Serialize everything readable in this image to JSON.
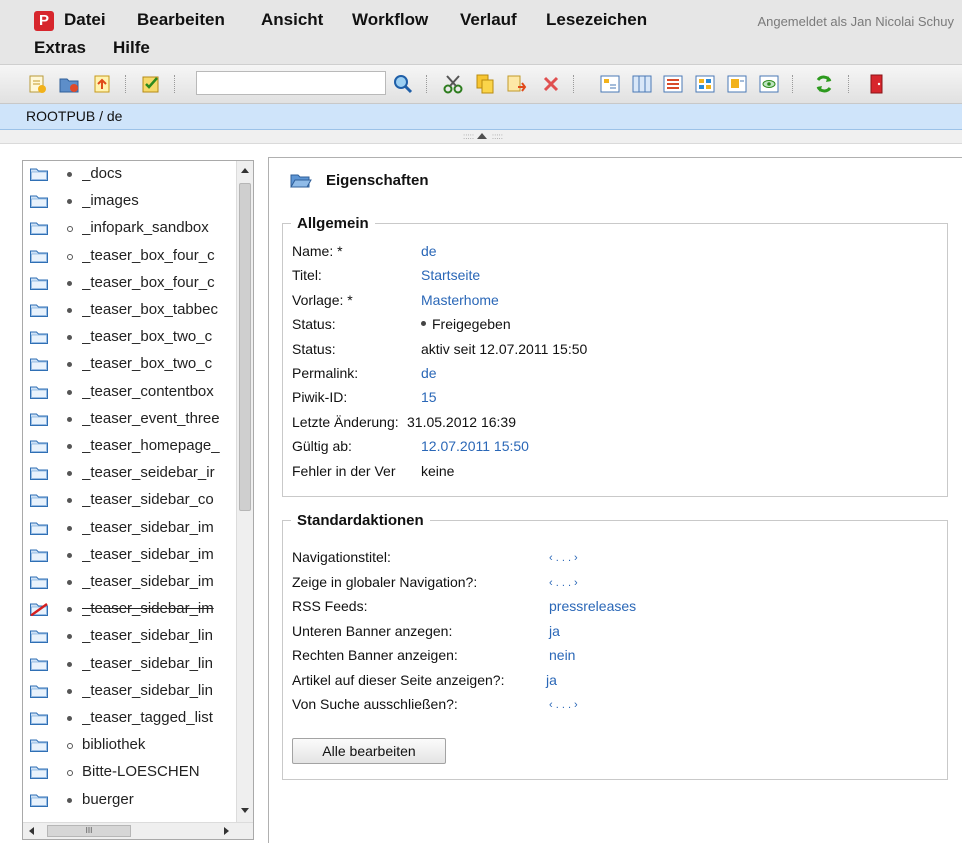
{
  "menubar": {
    "logo": "P",
    "items": [
      "Datei",
      "Bearbeiten",
      "Ansicht",
      "Workflow",
      "Verlauf",
      "Lesezeichen",
      "Extras",
      "Hilfe"
    ],
    "login": "Angemeldet als Jan Nicolai Schuy"
  },
  "toolbar": {
    "search_value": "",
    "icons": [
      "new-document-icon",
      "new-folder-icon",
      "import-icon",
      "checklist-icon",
      "search-icon",
      "cut-icon",
      "copy-icon",
      "paste-icon",
      "delete-icon",
      "view-tree-icon",
      "view-columns-icon",
      "view-list-icon",
      "view-details-icon",
      "view-preview-icon",
      "view-eye-icon",
      "refresh-icon",
      "exit-icon"
    ]
  },
  "breadcrumb": "ROOTPUB / de",
  "tree": {
    "items": [
      {
        "label": "_docs",
        "released": true,
        "deleted": false
      },
      {
        "label": "_images",
        "released": true,
        "deleted": false
      },
      {
        "label": "_infopark_sandbox",
        "released": false,
        "deleted": false
      },
      {
        "label": "_teaser_box_four_c",
        "released": false,
        "deleted": false
      },
      {
        "label": "_teaser_box_four_c",
        "released": true,
        "deleted": false
      },
      {
        "label": "_teaser_box_tabbec",
        "released": true,
        "deleted": false
      },
      {
        "label": "_teaser_box_two_c",
        "released": true,
        "deleted": false
      },
      {
        "label": "_teaser_box_two_c",
        "released": true,
        "deleted": false
      },
      {
        "label": "_teaser_contentbox",
        "released": true,
        "deleted": false
      },
      {
        "label": "_teaser_event_three",
        "released": true,
        "deleted": false
      },
      {
        "label": "_teaser_homepage_",
        "released": true,
        "deleted": false
      },
      {
        "label": "_teaser_seidebar_ir",
        "released": true,
        "deleted": false
      },
      {
        "label": "_teaser_sidebar_co",
        "released": true,
        "deleted": false
      },
      {
        "label": "_teaser_sidebar_im",
        "released": true,
        "deleted": false
      },
      {
        "label": "_teaser_sidebar_im",
        "released": true,
        "deleted": false
      },
      {
        "label": "_teaser_sidebar_im",
        "released": true,
        "deleted": false
      },
      {
        "label": "_teaser_sidebar_im",
        "released": true,
        "deleted": true
      },
      {
        "label": "_teaser_sidebar_lin",
        "released": true,
        "deleted": false
      },
      {
        "label": "_teaser_sidebar_lin",
        "released": true,
        "deleted": false
      },
      {
        "label": "_teaser_sidebar_lin",
        "released": true,
        "deleted": false
      },
      {
        "label": "_teaser_tagged_list",
        "released": true,
        "deleted": false
      },
      {
        "label": "bibliothek",
        "released": false,
        "deleted": false
      },
      {
        "label": "Bitte-LOESCHEN",
        "released": false,
        "deleted": false
      },
      {
        "label": "buerger",
        "released": true,
        "deleted": false
      }
    ]
  },
  "detail": {
    "title": "Eigenschaften",
    "general": {
      "legend": "Allgemein",
      "rows": [
        {
          "label": "Name: *",
          "value": "de",
          "link": true,
          "bullet": false
        },
        {
          "label": "Titel:",
          "value": "Startseite",
          "link": true,
          "bullet": false
        },
        {
          "label": "Vorlage: *",
          "value": "Masterhome",
          "link": true,
          "bullet": false
        },
        {
          "label": "Status:",
          "value": "Freigegeben",
          "link": false,
          "bullet": true
        },
        {
          "label": "Status:",
          "value": "aktiv seit 12.07.2011 15:50",
          "link": false,
          "bullet": false
        },
        {
          "label": "Permalink:",
          "value": "de",
          "link": true,
          "bullet": false
        },
        {
          "label": "Piwik-ID:",
          "value": "15",
          "link": true,
          "bullet": false
        },
        {
          "label": "Letzte Änderung:",
          "value": "31.05.2012 16:39",
          "link": false,
          "bullet": false
        },
        {
          "label": "Gültig ab:",
          "value": "12.07.2011 15:50",
          "link": true,
          "bullet": false
        },
        {
          "label": "Fehler in der Ver",
          "value": "keine",
          "link": false,
          "bullet": false
        }
      ]
    },
    "standard": {
      "legend": "Standardaktionen",
      "rows": [
        {
          "label": "Navigationstitel:",
          "value": "‹ . . . ›"
        },
        {
          "label": "Zeige in globaler Navigation?:",
          "value": "‹ . . . ›"
        },
        {
          "label": "RSS Feeds:",
          "value": "pressreleases"
        },
        {
          "label": "Unteren Banner anzegen:",
          "value": "ja"
        },
        {
          "label": "Rechten Banner anzeigen:",
          "value": "nein"
        },
        {
          "label": "Artikel auf dieser Seite anzeigen?:",
          "value": "ja"
        },
        {
          "label": "Von Suche ausschließen?:",
          "value": "‹ . . . ›"
        }
      ],
      "button": "Alle bearbeiten"
    }
  }
}
